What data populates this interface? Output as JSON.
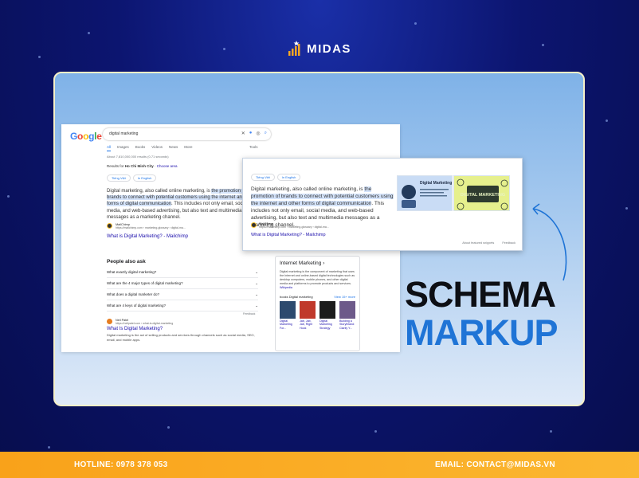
{
  "brand": {
    "name": "MIDAS"
  },
  "google": {
    "logo": [
      "G",
      "o",
      "o",
      "g",
      "l",
      "e"
    ],
    "query": "digital marketing",
    "tabs": [
      "All",
      "Images",
      "Books",
      "Videos",
      "News",
      "More"
    ],
    "tools": "Tools",
    "result_count": "About 7,810,000,000 results (0.71 seconds)",
    "results_for_prefix": "Results for ",
    "results_for_location": "Ho Chi Minh City",
    "results_for_link": "Choose area",
    "lang_options": [
      "Tiếng Việt",
      "In English"
    ],
    "snippet_pre": "Digital marketing, also called online marketing, is ",
    "snippet_hl": "the promotion of brands to connect with potential customers using the internet and other forms of digital communication",
    "snippet_post": ". This includes not only email, social media, and web-based advertising, but also text and multimedia messages as a marketing channel.",
    "source_name": "MailChimp",
    "source_url": "https://mailchimp.com › marketing-glossary › digital-ma...",
    "source_title": "What is Digital Marketing? - Mailchimp",
    "paa_title": "People also ask",
    "paa_items": [
      "What exactly digital marketing?",
      "What are the 4 major types of digital marketing?",
      "What does a digital marketer do?",
      "What are 4 keys of digital marketing?"
    ],
    "feedback": "Feedback",
    "result2": {
      "source_name": "Neil Patel",
      "source_url": "https://neilpatel.com › what-is-digital-marketing",
      "title": "What Is Digital Marketing?",
      "text": "Digital marketing is the act of selling products and services through channels such as social media, SEO, email, and mobile apps."
    },
    "kp": {
      "title": "Internet Marketing",
      "text": "Digital marketing is the component of marketing that uses the Internet and online-based digital technologies such as desktop computers, mobile phones, and other digital media and platforms to promote products and services.",
      "wiki": "Wikipedia",
      "books_header": "books Digital marketing",
      "books_more": "View 15+ more",
      "books": [
        "Digital Marketing For...",
        "Jab, Jab, Jab, Right Hook",
        "Digital Marketing Strategy",
        "Building a StoryBrand: Clarify Y..."
      ],
      "book_colors": [
        "#2d4a6e",
        "#c0392b",
        "#1c1c1c",
        "#6d5a8a"
      ]
    },
    "zoom_images": [
      "Digital Marketing",
      "DIGITAL MARKETING"
    ],
    "zoom_footer": [
      "About featured snippets",
      "Feedback"
    ]
  },
  "headline": {
    "line1": "SCHEMA",
    "line2": "MARKUP"
  },
  "footer": {
    "hotline": "HOTLINE: 0978 378 053",
    "email": "EMAIL: CONTACT@MIDAS.VN"
  },
  "colors": {
    "accent": "#1f74d6",
    "footer": "#f9a21a",
    "highlight": "#d5e4fb"
  }
}
